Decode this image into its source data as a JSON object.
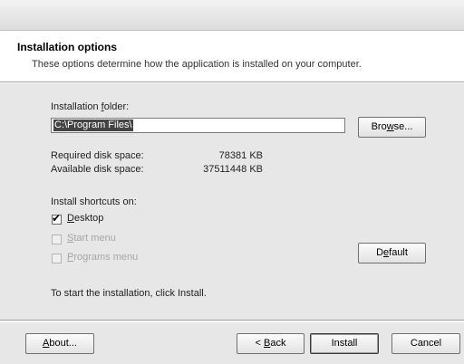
{
  "header": {
    "title": "Installation options",
    "subtitle": "These options determine how the application is installed on your computer."
  },
  "folder": {
    "label": "Installation folder:",
    "value": "C:\\Program Files\\",
    "browse_label": "Browse..."
  },
  "disk": {
    "required_label": "Required disk space:",
    "required_value": "78381 KB",
    "available_label": "Available disk space:",
    "available_value": "37511448 KB"
  },
  "shortcuts": {
    "label": "Install shortcuts on:",
    "items": [
      {
        "label": "Desktop",
        "checked": true,
        "enabled": true
      },
      {
        "label": "Start menu",
        "checked": false,
        "enabled": false
      },
      {
        "label": "Programs menu",
        "checked": false,
        "enabled": false
      }
    ],
    "default_label": "Default"
  },
  "instruction": "To start the installation, click Install.",
  "buttons": {
    "about": "About...",
    "back": "< Back",
    "install": "Install",
    "cancel": "Cancel"
  }
}
